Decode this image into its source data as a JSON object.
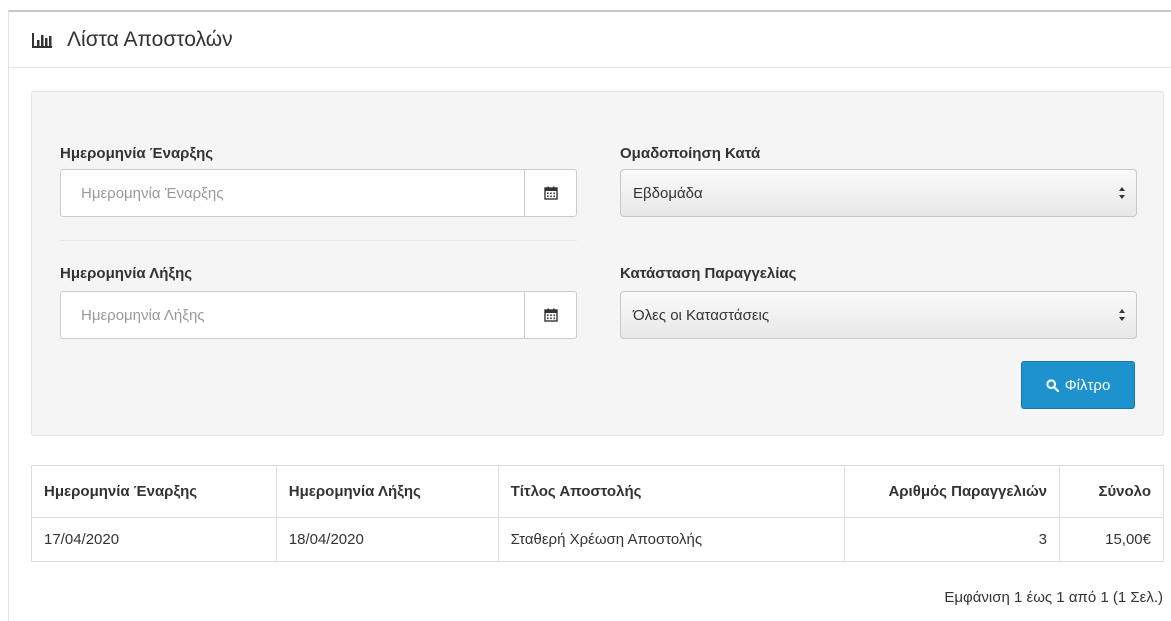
{
  "header": {
    "title": "Λίστα Αποστολών",
    "icon": "bar-chart-icon"
  },
  "filter": {
    "start_date": {
      "label": "Ημερομηνία Έναρξης",
      "placeholder": "Ημερομηνία Έναρξης",
      "value": ""
    },
    "end_date": {
      "label": "Ημερομηνία Λήξης",
      "placeholder": "Ημερομηνία Λήξης",
      "value": ""
    },
    "group_by": {
      "label": "Ομαδοποίηση Κατά",
      "selected": "Εβδομάδα"
    },
    "order_status": {
      "label": "Κατάσταση Παραγγελίας",
      "selected": "Όλες οι Καταστάσεις"
    },
    "button_label": "Φίλτρο",
    "button_color": "#1e91cf"
  },
  "table": {
    "headers": [
      "Ημερομηνία Έναρξης",
      "Ημερομηνία Λήξης",
      "Τίτλος Αποστολής",
      "Αριθμός Παραγγελιών",
      "Σύνολο"
    ],
    "rows": [
      [
        "17/04/2020",
        "18/04/2020",
        "Σταθερή Χρέωση Αποστολής",
        "3",
        "15,00€"
      ]
    ]
  },
  "pagination": {
    "text": "Εμφάνιση 1 έως 1 από 1 (1 Σελ.)"
  }
}
